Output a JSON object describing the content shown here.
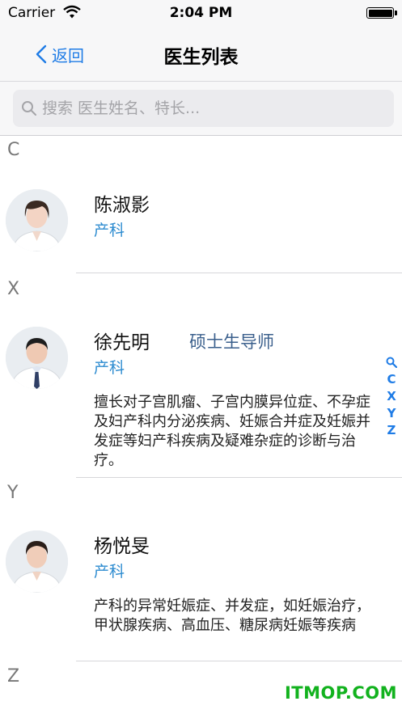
{
  "status_bar": {
    "carrier": "Carrier",
    "time": "2:04 PM"
  },
  "nav": {
    "back_label": "返回",
    "title": "医生列表"
  },
  "search": {
    "placeholder": "搜索 医生姓名、特长..."
  },
  "sections": [
    {
      "letter": "C"
    },
    {
      "letter": "X"
    },
    {
      "letter": "Y"
    },
    {
      "letter": "Z"
    }
  ],
  "doctors": [
    {
      "name": "陈淑影",
      "dept": "产科",
      "title": "",
      "desc": ""
    },
    {
      "name": "徐先明",
      "dept": "产科",
      "title": "硕士生导师",
      "desc": "擅长对子宫肌瘤、子宫内膜异位症、不孕症及妇产科内分泌疾病、妊娠合并症及妊娠并发症等妇产科疾病及疑难杂症的诊断与治疗。"
    },
    {
      "name": "杨悦旻",
      "dept": "产科",
      "title": "",
      "desc": "产科的异常妊娠症、并发症，如妊娠治疗，甲状腺疾病、高血压、糖尿病妊娠等疾病"
    }
  ],
  "index_bar": {
    "letters": [
      "C",
      "X",
      "Y",
      "Z"
    ],
    "search_icon": "search-icon"
  },
  "watermark": "ITMOP.COM",
  "colors": {
    "accent": "#1f7ce6",
    "dept": "#2c8bd0",
    "watermark": "#12b21e"
  }
}
